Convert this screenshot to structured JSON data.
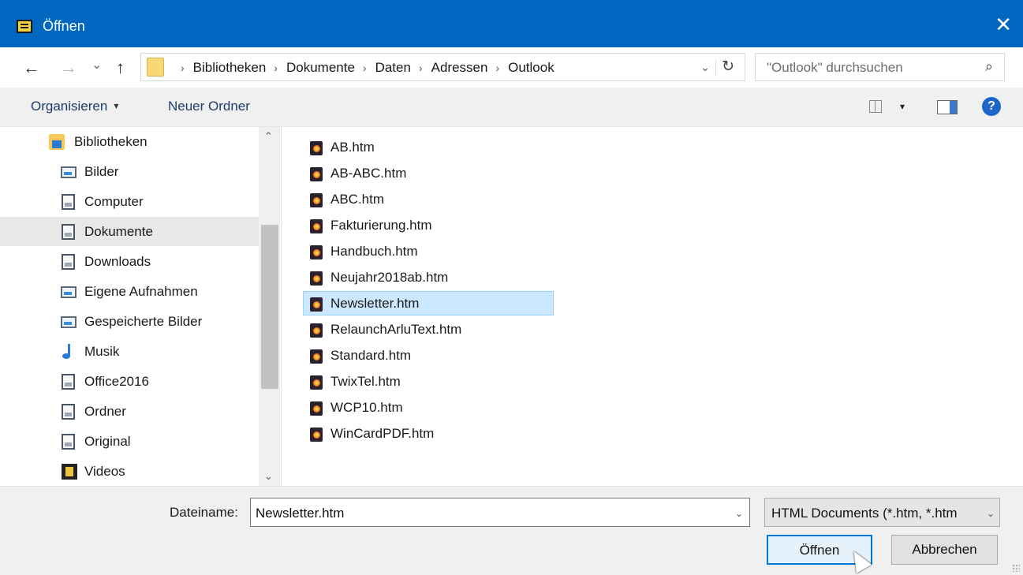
{
  "window": {
    "title": "Öffnen",
    "close_symbol": "✕",
    "accent": "#0067c0"
  },
  "address_bar": {
    "back_symbol": "←",
    "forward_symbol": "→",
    "recent_symbol": "⌄",
    "up_symbol": "↑",
    "breadcrumbs": [
      "Bibliotheken",
      "Dokumente",
      "Daten",
      "Adressen",
      "Outlook"
    ],
    "separator": "›",
    "dropdown_symbol": "⌄",
    "refresh_symbol": "↻",
    "search_placeholder": "\"Outlook\" durchsuchen",
    "search_symbol": "⌕"
  },
  "toolbar": {
    "organize_label": "Organisieren",
    "new_folder_label": "Neuer Ordner",
    "caret": "▾",
    "help_symbol": "?"
  },
  "nav": {
    "items": [
      {
        "label": "Bibliotheken",
        "icon": "library-icon"
      },
      {
        "label": "Bilder",
        "icon": "pictures-icon"
      },
      {
        "label": "Computer",
        "icon": "document-icon"
      },
      {
        "label": "Dokumente",
        "icon": "documents-icon",
        "selected": true
      },
      {
        "label": "Downloads",
        "icon": "document-icon"
      },
      {
        "label": "Eigene Aufnahmen",
        "icon": "pictures-icon"
      },
      {
        "label": "Gespeicherte Bilder",
        "icon": "pictures-icon"
      },
      {
        "label": "Musik",
        "icon": "music-icon"
      },
      {
        "label": "Office2016",
        "icon": "document-icon"
      },
      {
        "label": "Ordner",
        "icon": "document-icon"
      },
      {
        "label": "Original",
        "icon": "document-icon"
      },
      {
        "label": "Videos",
        "icon": "video-icon"
      }
    ],
    "scroll_up_symbol": "⌃",
    "scroll_down_symbol": "⌄"
  },
  "files": {
    "items": [
      "AB.htm",
      "AB-ABC.htm",
      "ABC.htm",
      "Fakturierung.htm",
      "Handbuch.htm",
      "Neujahr2018ab.htm",
      "Newsletter.htm",
      "RelaunchArluText.htm",
      "Standard.htm",
      "TwixTel.htm",
      "WCP10.htm",
      "WinCardPDF.htm"
    ],
    "selected": "Newsletter.htm"
  },
  "bottom": {
    "filename_label": "Dateiname:",
    "filename_value": "Newsletter.htm",
    "filetype_value": "HTML Documents (*.htm, *.htm",
    "dropdown_symbol": "⌄",
    "open_label": "Öffnen",
    "cancel_label": "Abbrechen"
  }
}
